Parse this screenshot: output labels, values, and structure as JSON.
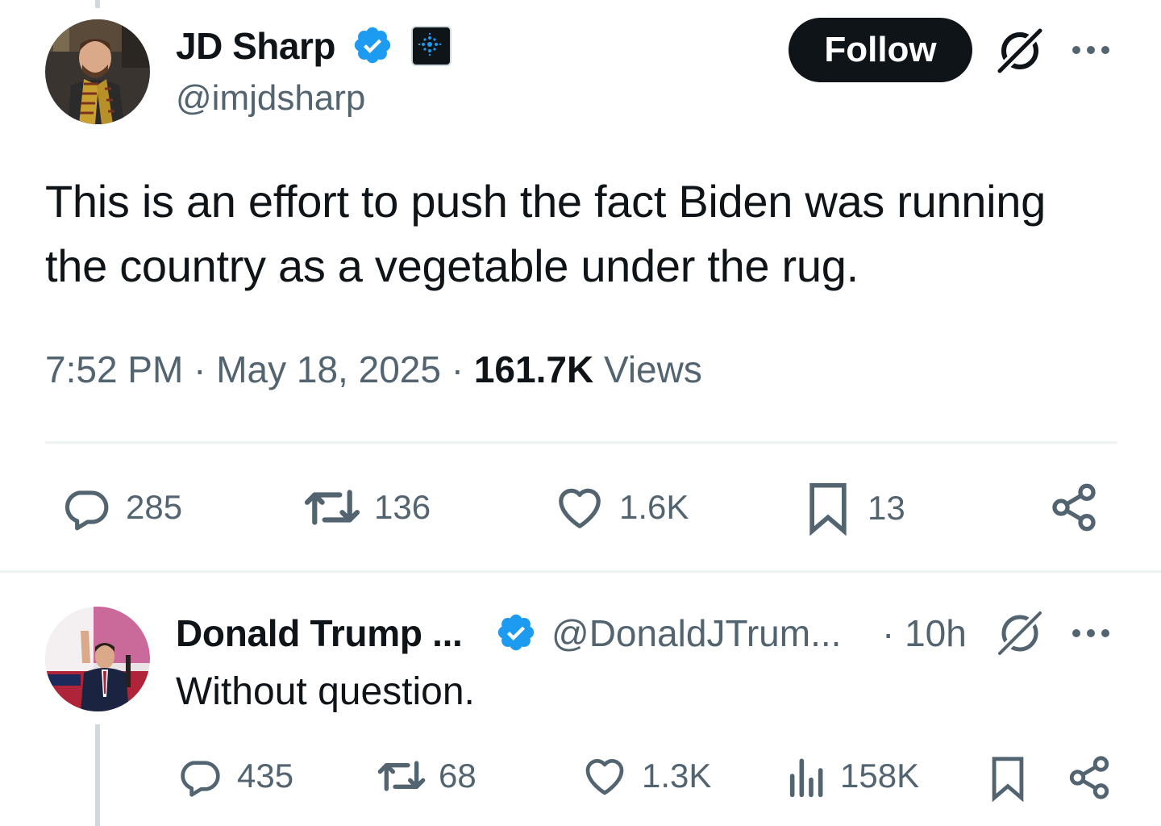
{
  "tweet": {
    "author": {
      "name": "JD Sharp",
      "handle": "@imjdsharp"
    },
    "follow_label": "Follow",
    "text": "This is an effort to push the fact Biden was running the country as a vegetable under the rug.",
    "time": "7:52 PM",
    "date": "May 18, 2025",
    "views_count": "161.7K",
    "views_label": "Views",
    "separator": "·",
    "stats": {
      "replies": "285",
      "reposts": "136",
      "likes": "1.6K",
      "bookmarks": "13"
    }
  },
  "reply": {
    "author": {
      "name": "Donald Trump ...",
      "handle": "@DonaldJTrum...",
      "age": "· 10h"
    },
    "text": "Without question.",
    "stats": {
      "replies": "435",
      "reposts": "68",
      "likes": "1.3K",
      "views": "158K"
    }
  },
  "icons": {
    "verified": "verified-badge-icon",
    "affiliate": "affiliate-badge-icon",
    "grok": "grok-icon",
    "more": "more-icon",
    "reply": "reply-icon",
    "repost": "repost-icon",
    "like": "heart-icon",
    "bookmark": "bookmark-icon",
    "share": "share-icon",
    "views": "analytics-icon"
  },
  "colors": {
    "text": "#0f1419",
    "secondary": "#536471",
    "verified": "#1d9bf0",
    "follow_bg": "#0f1419",
    "divider": "#eff3f4"
  }
}
